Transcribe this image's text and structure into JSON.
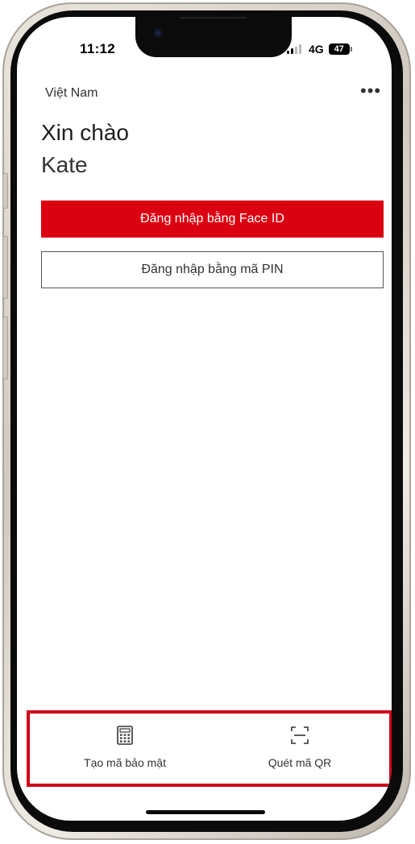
{
  "status_bar": {
    "time": "11:12",
    "network": "4G",
    "battery_level": "47",
    "signal_bars_active": 2,
    "signal_bars_total": 4
  },
  "header": {
    "region": "Việt Nam",
    "menu_icon": "more-dots-icon",
    "menu_glyph": "•••"
  },
  "greeting": {
    "line1": "Xin chào",
    "line2": "Kate"
  },
  "buttons": {
    "faceid_label": "Đăng nhập bằng Face ID",
    "pin_label": "Đăng nhập bằng mã PIN"
  },
  "bottom_actions": [
    {
      "label": "Tạo mã bảo mật",
      "icon": "calculator-icon"
    },
    {
      "label": "Quét mã QR",
      "icon": "qr-scan-icon"
    }
  ],
  "colors": {
    "brand_red": "#db0011",
    "highlight_red": "#d0021b",
    "text_dark": "#333333"
  }
}
